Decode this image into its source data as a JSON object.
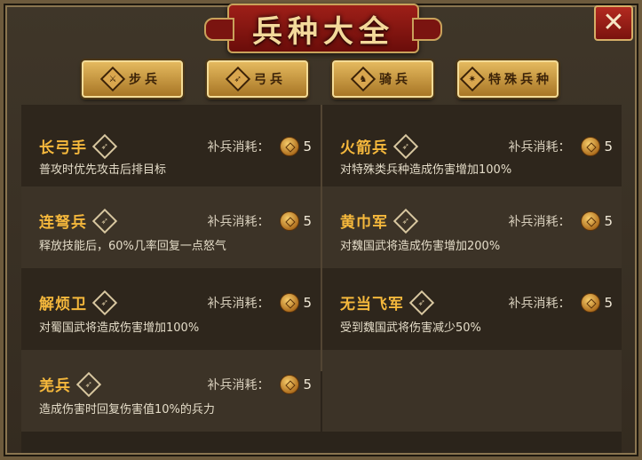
{
  "title": "兵种大全",
  "close_icon": "close-x-icon",
  "tabs": [
    {
      "label": "步兵",
      "icon": "infantry-icon"
    },
    {
      "label": "弓兵",
      "icon": "bow-icon"
    },
    {
      "label": "骑兵",
      "icon": "horse-icon"
    },
    {
      "label": "特殊兵种",
      "icon": "special-icon"
    }
  ],
  "cost_label": "补兵消耗：",
  "units": [
    {
      "name": "长弓手",
      "cost": "5",
      "desc": "普攻时优先攻击后排目标"
    },
    {
      "name": "火箭兵",
      "cost": "5",
      "desc": "对特殊类兵种造成伤害增加100%"
    },
    {
      "name": "连弩兵",
      "cost": "5",
      "desc": "释放技能后，60%几率回复一点怒气"
    },
    {
      "name": "黄巾军",
      "cost": "5",
      "desc": "对魏国武将造成伤害增加200%"
    },
    {
      "name": "解烦卫",
      "cost": "5",
      "desc": "对蜀国武将造成伤害增加100%"
    },
    {
      "name": "无当飞军",
      "cost": "5",
      "desc": "受到魏国武将伤害减少50%"
    },
    {
      "name": "羌兵",
      "cost": "5",
      "desc": "造成伤害时回复伤害值10%的兵力"
    }
  ],
  "colors": {
    "accent": "#f5b83c",
    "banner": "#9e1f18",
    "tab": "#d9a64e"
  }
}
